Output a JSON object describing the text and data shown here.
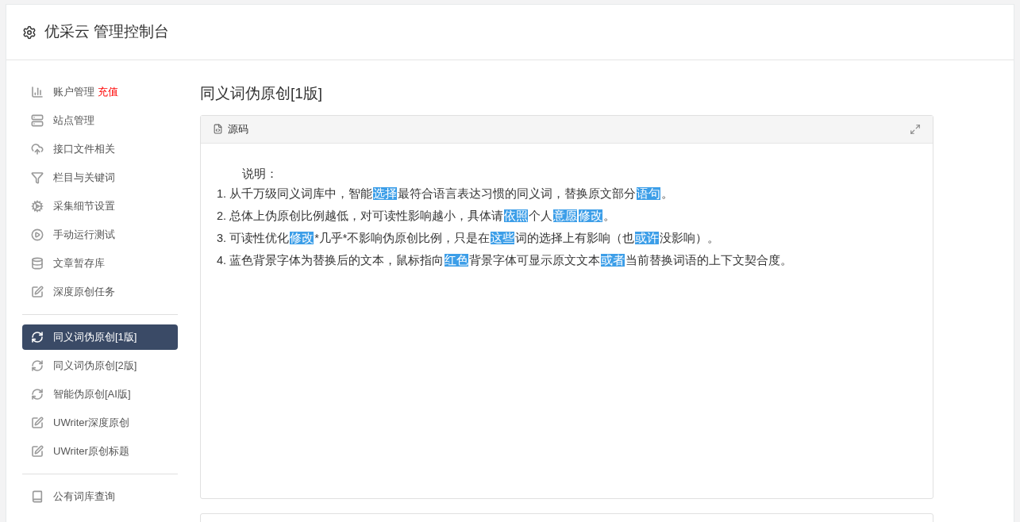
{
  "header": {
    "title": "优采云 管理控制台"
  },
  "sidebar": {
    "groups": [
      {
        "items": [
          {
            "kind": "chart",
            "label": "账户管理",
            "badge": "充值",
            "selected": false
          },
          {
            "kind": "server",
            "label": "站点管理",
            "selected": false
          },
          {
            "kind": "cloud",
            "label": "接口文件相关",
            "selected": false
          },
          {
            "kind": "filter",
            "label": "栏目与关键词",
            "selected": false
          },
          {
            "kind": "gears",
            "label": "采集细节设置",
            "selected": false
          },
          {
            "kind": "play",
            "label": "手动运行测试",
            "selected": false
          },
          {
            "kind": "database",
            "label": "文章暂存库",
            "selected": false
          },
          {
            "kind": "edit",
            "label": "深度原创任务",
            "selected": false
          }
        ]
      },
      {
        "items": [
          {
            "kind": "refresh",
            "label": "同义词伪原创[1版]",
            "selected": true
          },
          {
            "kind": "refresh",
            "label": "同义词伪原创[2版]",
            "selected": false
          },
          {
            "kind": "refresh",
            "label": "智能伪原创[AI版]",
            "selected": false
          },
          {
            "kind": "edit",
            "label": "UWriter深度原创",
            "selected": false
          },
          {
            "kind": "edit",
            "label": "UWriter原创标题",
            "selected": false
          }
        ]
      },
      {
        "items": [
          {
            "kind": "book",
            "label": "公有词库查询",
            "selected": false
          }
        ]
      }
    ]
  },
  "main": {
    "title": "同义词伪原创[1版]",
    "panel": {
      "header": "源码",
      "intro": "说明：",
      "lines": [
        [
          {
            "text": "1. 从千万级同义词库中，智能",
            "highlighted": false
          },
          {
            "text": "选择",
            "highlighted": true
          },
          {
            "text": "最符合语言表达习惯的同义词，替换原文部分",
            "highlighted": false
          },
          {
            "text": "语句",
            "highlighted": true
          },
          {
            "text": "。",
            "highlighted": false
          }
        ],
        [
          {
            "text": "2. 总体上伪原创比例越低，对可读性影响越小，具体请",
            "highlighted": false
          },
          {
            "text": "依照",
            "highlighted": true
          },
          {
            "text": "个人",
            "highlighted": false
          },
          {
            "text": "意愿",
            "highlighted": true
          },
          {
            "text": "修改",
            "highlighted": true
          },
          {
            "text": "。",
            "highlighted": false
          }
        ],
        [
          {
            "text": "3. 可读性优化",
            "highlighted": false
          },
          {
            "text": "修改",
            "highlighted": true
          },
          {
            "text": "*几乎*不影响伪原创比例，只是在",
            "highlighted": false
          },
          {
            "text": "这些",
            "highlighted": true
          },
          {
            "text": "词的选择上有影响（也",
            "highlighted": false
          },
          {
            "text": "或许",
            "highlighted": true
          },
          {
            "text": "没影响）。",
            "highlighted": false
          }
        ],
        [
          {
            "text": "4. 蓝色背景字体为替换后的文本，鼠标指向",
            "highlighted": false
          },
          {
            "text": "红色",
            "highlighted": true
          },
          {
            "text": "背景字体可显示原文文本",
            "highlighted": false
          },
          {
            "text": "或者",
            "highlighted": true
          },
          {
            "text": "当前替换词语的上下文契合度。",
            "highlighted": false
          }
        ]
      ]
    }
  }
}
